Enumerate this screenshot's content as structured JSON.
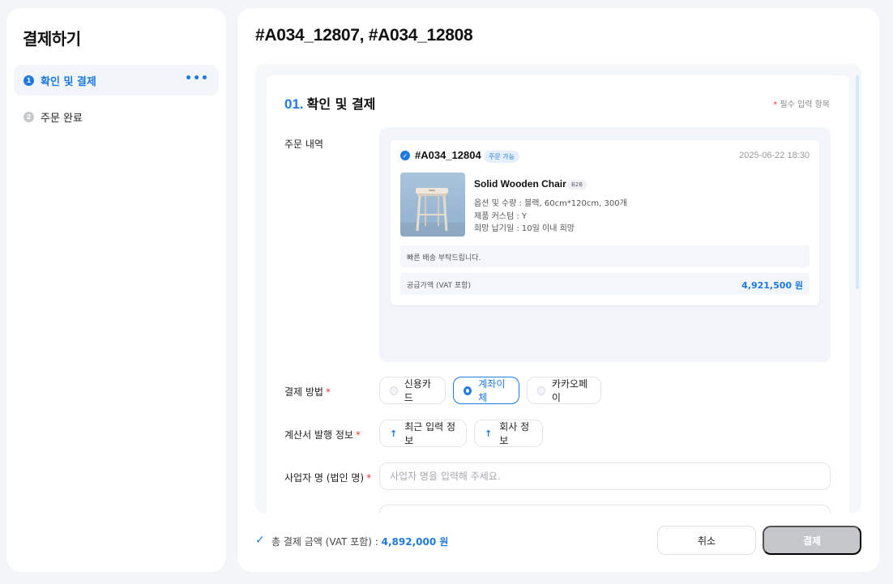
{
  "sidebar": {
    "title": "결제하기",
    "steps": [
      {
        "num": "1",
        "label": "확인 및 결제",
        "more": "•••"
      },
      {
        "num": "2",
        "label": "주문 완료"
      }
    ]
  },
  "header": {
    "order_ids": "#A034_12807, #A034_12808"
  },
  "section": {
    "num": "01.",
    "title": "확인 및 결제",
    "required_mark": "*",
    "required_note": "필수 입력 항목"
  },
  "fields": {
    "order_details_label": "주문 내역",
    "payment_method_label": "결제 방법",
    "invoice_label": "계산서 발행 정보",
    "business_name_label": "사업자 명 (법인 명)",
    "required_mark": "*"
  },
  "order": {
    "id": "#A034_12804",
    "status": "주문 가능",
    "date": "2025-06-22 18:30",
    "product": {
      "name": "Solid Wooden Chair",
      "badge": "B2B",
      "options": "옵션 및 수량 : 블랙, 60cm*120cm, 300개",
      "custom": "제품 커스텀 : Y",
      "delivery": "희망 납기일 : 10일 이내 희망"
    },
    "memo": "빠른 배송 부탁드립니다.",
    "price_label": "공급가액 (VAT 포함)",
    "price_value": "4,921,500 원"
  },
  "payment_methods": [
    {
      "label": "신용카드",
      "selected": false
    },
    {
      "label": "계좌이체",
      "selected": true
    },
    {
      "label": "카카오페이",
      "selected": false
    }
  ],
  "invoice_buttons": [
    {
      "label": "최근 입력 정보"
    },
    {
      "label": "회사 정보"
    }
  ],
  "business_name": {
    "placeholder": "사업자 명을 입력해 주세요.",
    "value": ""
  },
  "footer": {
    "total_label": "총 결제 금액 (VAT 포함) :",
    "total_value": "4,892,000 원",
    "cancel_label": "취소",
    "pay_label": "결제"
  },
  "colors": {
    "accent": "#1f7ae0",
    "required": "#e03b3b",
    "disabled": "#c4c6c9"
  }
}
